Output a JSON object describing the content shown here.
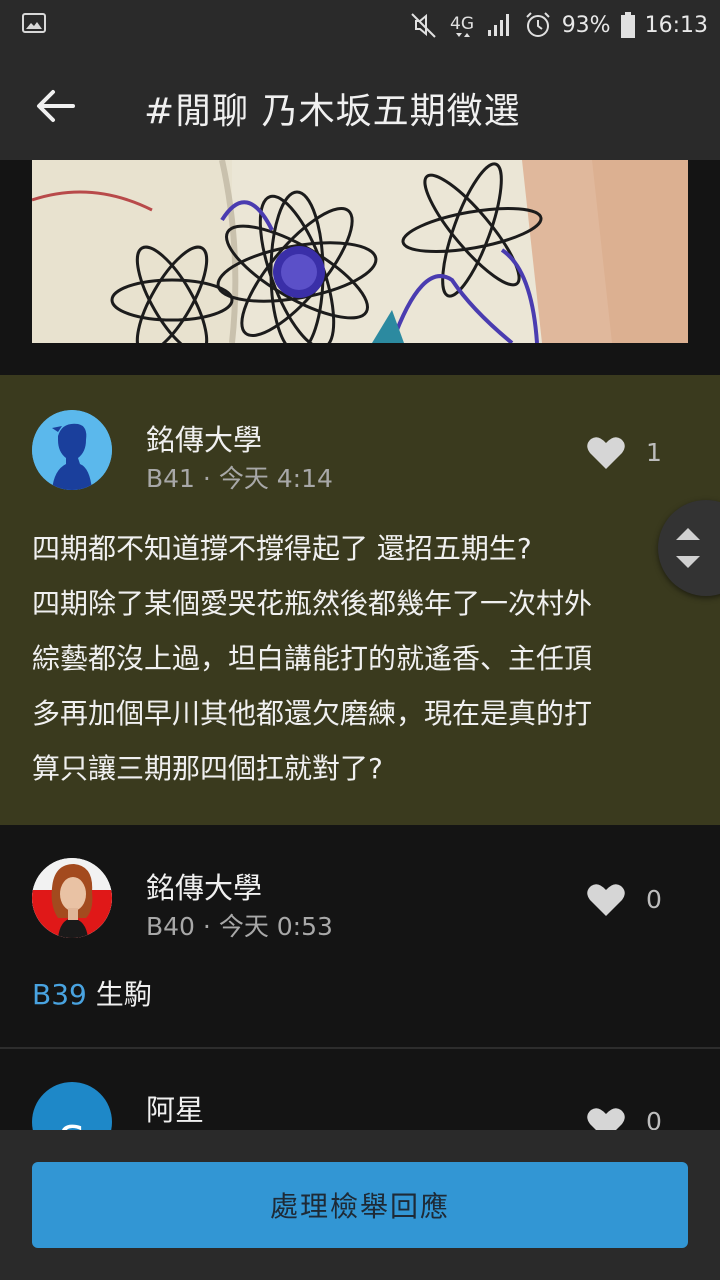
{
  "status_bar": {
    "battery_percent": "93%",
    "time": "16:13",
    "network": "4G",
    "icons": [
      "gallery-icon",
      "mute-icon",
      "network-4g-icon",
      "signal-icon",
      "alarm-icon",
      "battery-icon"
    ]
  },
  "appbar": {
    "title": "#閒聊 乃木坂五期徵選",
    "back_icon": "arrow-left-icon"
  },
  "comments": [
    {
      "author": "銘傳大學",
      "floor": "B41",
      "separator": "·",
      "time": "今天 4:14",
      "likes": "1",
      "lines": [
        "四期都不知道撐不撐得起了 還招五期生?",
        "四期除了某個愛哭花瓶然後都幾年了一次村外",
        "綜藝都沒上過，坦白講能打的就遙香、主任頂",
        "多再加個早川其他都還欠磨練，現在是真的打",
        "算只讓三期那四個扛就對了?"
      ],
      "avatar_icon": "person-silhouette-icon",
      "avatar_color": "#5bb8ec"
    },
    {
      "author": "銘傳大學",
      "floor": "B40",
      "separator": "·",
      "time": "今天 0:53",
      "likes": "0",
      "reply_ref": "B39",
      "text": "生駒",
      "avatar_icon": "portrait-avatar-icon"
    },
    {
      "author": "阿星",
      "likes": "0",
      "avatar_letter": "S",
      "avatar_color": "#1e88c8"
    }
  ],
  "bottom": {
    "action_label": "處理檢舉回應"
  },
  "colors": {
    "highlight_bg": "#3a3a1e",
    "accent": "#3296d4",
    "reply_ref": "#49a3e0",
    "bar_bg": "#2a2a2a",
    "page_bg": "#141414"
  }
}
